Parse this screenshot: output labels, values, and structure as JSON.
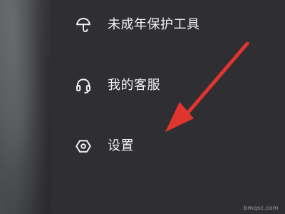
{
  "menu": {
    "items": [
      {
        "label": "未成年保护工具",
        "icon": "umbrella-icon"
      },
      {
        "label": "我的客服",
        "icon": "headset-icon"
      },
      {
        "label": "设置",
        "icon": "settings-hexagon-icon"
      }
    ]
  },
  "watermark": {
    "text": "bmqsc.com"
  },
  "colors": {
    "drawer_background": "#2f2f33",
    "menu_text": "#f2f2f2",
    "arrow": "#e0342f"
  }
}
